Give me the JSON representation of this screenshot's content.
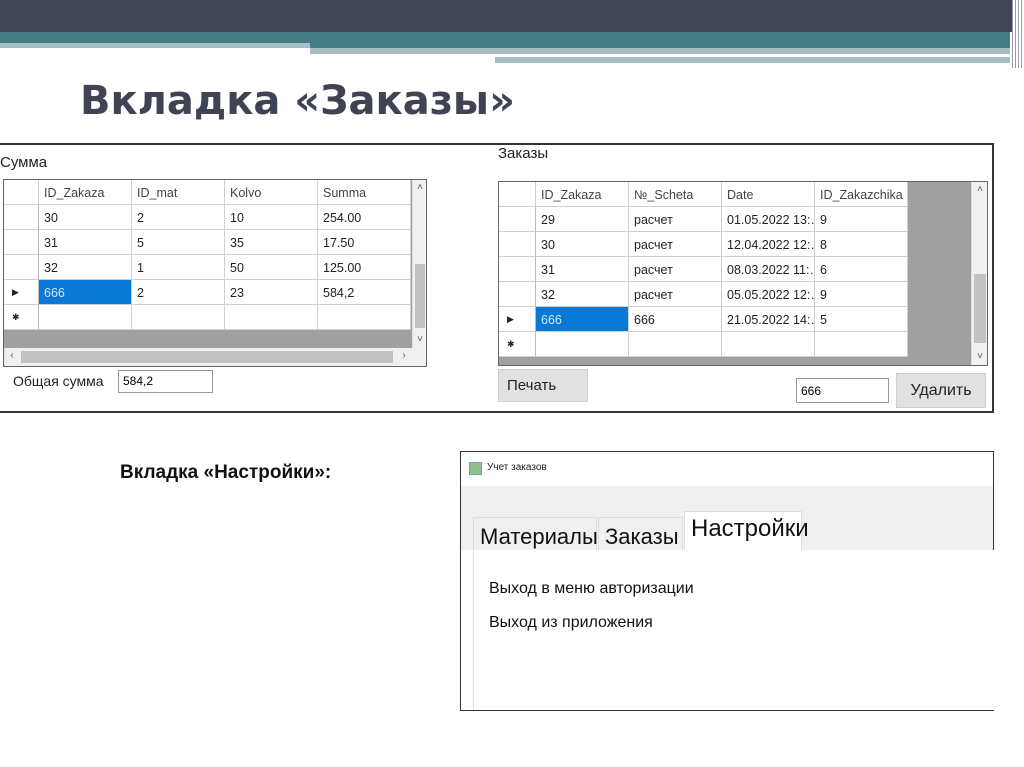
{
  "slide": {
    "title": "Вкладка «Заказы»",
    "subtitle": "Вкладка «Настройки»:"
  },
  "left_panel": {
    "label": "Сумма",
    "columns": [
      "ID_Zakaza",
      "ID_mat",
      "Kolvo",
      "Summa"
    ],
    "rows": [
      [
        "30",
        "2",
        "10",
        "254.00"
      ],
      [
        "31",
        "5",
        "35",
        "17.50"
      ],
      [
        "32",
        "1",
        "50",
        "125.00"
      ],
      [
        "666",
        "2",
        "23",
        "584,2"
      ]
    ],
    "selected_row": 3,
    "total_label": "Общая сумма",
    "total_value": "584,2"
  },
  "right_panel": {
    "label": "Заказы",
    "columns": [
      "ID_Zakaza",
      "№_Scheta",
      "Date",
      "ID_Zakazchika"
    ],
    "rows": [
      [
        "29",
        "расчет",
        "01.05.2022 13:…",
        "9"
      ],
      [
        "30",
        "расчет",
        "12.04.2022 12:…",
        "8"
      ],
      [
        "31",
        "расчет",
        "08.03.2022 11:…",
        "6"
      ],
      [
        "32",
        "расчет",
        "05.05.2022 12:…",
        "9"
      ],
      [
        "666",
        "666",
        "21.05.2022 14:…",
        "5"
      ]
    ],
    "selected_row": 4,
    "print_button": "Печать",
    "delete_input_value": "666",
    "delete_button": "Удалить"
  },
  "settings_window": {
    "title": "Учет заказов",
    "tabs": [
      {
        "label": "Материалы",
        "active": false
      },
      {
        "label": "Заказы",
        "active": false
      },
      {
        "label": "Настройки",
        "active": true
      }
    ],
    "links": [
      "Выход в меню авторизации",
      "Выход из приложения"
    ]
  },
  "icons": {
    "current_row": "triangle-right",
    "new_row": "asterisk",
    "scroll_up": "chevron-up",
    "scroll_down": "chevron-down",
    "scroll_left": "chevron-left",
    "scroll_right": "chevron-right",
    "app": "window-app-icon"
  },
  "colors": {
    "selection": "#0a78d7",
    "header_dark": "#424457",
    "header_teal": "#447e84"
  }
}
